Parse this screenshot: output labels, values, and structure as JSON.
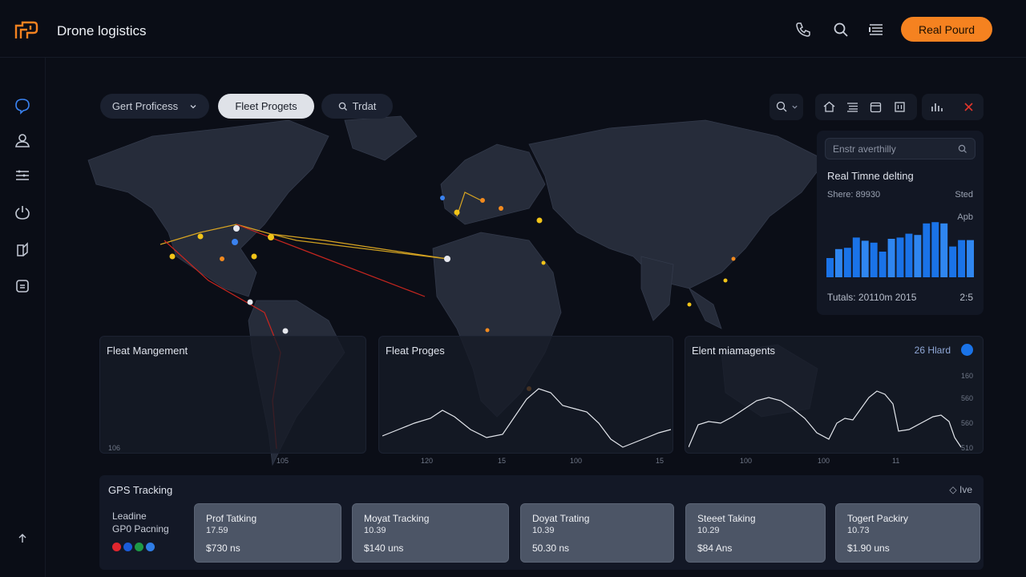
{
  "app": {
    "title": "Drone logistics",
    "logo_icon": "drone-logo-icon"
  },
  "header": {
    "icons": [
      "phone-icon",
      "search-icon",
      "list-icon"
    ],
    "cta_label": "Real Pourd",
    "accent": "#f58220"
  },
  "sidebar": {
    "items": [
      {
        "icon": "chat-icon",
        "active": true
      },
      {
        "icon": "user-icon"
      },
      {
        "icon": "list-icon"
      },
      {
        "icon": "power-icon"
      },
      {
        "icon": "document-icon"
      },
      {
        "icon": "box-icon"
      }
    ],
    "bottom_icon": "arrow-up-icon"
  },
  "filters": [
    {
      "label": "Gert Proficess",
      "has_dropdown": true
    },
    {
      "label": "Fleet Progets",
      "active": true
    },
    {
      "label": "Trdat",
      "icon": "search-icon"
    }
  ],
  "right_panel": {
    "search_placeholder": "Enstr averthilly",
    "title": "Real Timne delting",
    "left_label": "Shere:",
    "left_value": "89930",
    "right_label": "Sted",
    "sub_label": "Apb",
    "bar_values": [
      30,
      44,
      46,
      62,
      57,
      54,
      40,
      60,
      62,
      68,
      66,
      84,
      86,
      84,
      48,
      58,
      58
    ],
    "footer_label": "Tutals: 20110m 2015",
    "footer_value": "2:5",
    "bar_color": "#1a73e8"
  },
  "cards": [
    {
      "title": "Fleat Mangement",
      "tick_left": "106",
      "tick_bottom": "105"
    },
    {
      "title": "Fleat Proges",
      "ticks_bottom": [
        "120",
        "15",
        "100",
        "15"
      ]
    },
    {
      "title": "Elent miamagents",
      "count": "26 Hlard",
      "ticks_right": [
        "160",
        "560",
        "560",
        "510"
      ],
      "ticks_bottom": [
        "100",
        "100",
        "11"
      ]
    }
  ],
  "gps": {
    "title": "GPS Tracking",
    "live_label": "Ive",
    "legend_line1": "Leadine",
    "legend_line2": "GP0 Pacning",
    "legend_colors": [
      "#e0262e",
      "#1a5bd8",
      "#1e9a46",
      "#2f7de6"
    ],
    "cards": [
      {
        "title": "Prof Tatking",
        "value": "17.59",
        "price": "$730 ns"
      },
      {
        "title": "Moyat Tracking",
        "value": "10.39",
        "price": "$140 uns"
      },
      {
        "title": "Doyat Trating",
        "value": "10.39",
        "price": "50.30 ns"
      },
      {
        "title": "Steeet Taking",
        "value": "10.29",
        "price": "$84 Ans"
      },
      {
        "title": "Togert Packiry",
        "value": "10.73",
        "price": "$1.90 uns"
      }
    ]
  }
}
